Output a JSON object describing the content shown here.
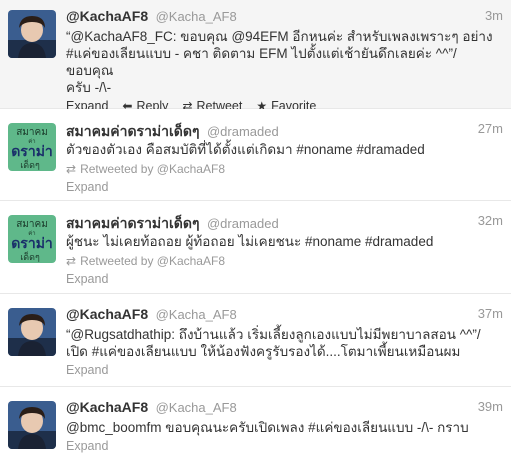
{
  "tweets": [
    {
      "fullname": "@KachaAF8",
      "username": "@Kacha_AF8",
      "time": "3m",
      "lines": [
        "“@KachaAF8_FC: ขอบคุณ @94EFM อีกหนค่ะ สำหรับเพลงเพราะๆ อย่าง",
        "#แค่ของเลียนแบบ - คชา ติดตาม EFM ไปตั้งแต่เช้ายันดึกเลยค่ะ ^^”/ขอบคุณ",
        "ครับ -/\\-"
      ],
      "expand": "Expand",
      "actions": {
        "reply": "Reply",
        "retweet": "Retweet",
        "favorite": "Favorite"
      },
      "avatar_icon": "person-photo",
      "highlight": true
    },
    {
      "fullname": "สมาคมค่าดราม่าเด็ดๆ",
      "username": "@dramaded",
      "time": "27m",
      "lines": [
        "ตัวของตัวเอง คือสมบัติที่ได้ตั้งแต่เกิดมา #noname #dramaded"
      ],
      "retweeted_by": "Retweeted by @KachaAF8",
      "expand": "Expand",
      "avatar_icon": "drama-logo",
      "avatar_text": {
        "top": "สมาคม",
        "mid": "ค่า",
        "main": "ดราม่า",
        "bottom": "เด็ดๆ"
      }
    },
    {
      "fullname": "สมาคมค่าดราม่าเด็ดๆ",
      "username": "@dramaded",
      "time": "32m",
      "lines": [
        "ผู้ชนะ ไม่เคยท้อถอย ผู้ท้อถอย ไม่เคยชนะ #noname #dramaded"
      ],
      "retweeted_by": "Retweeted by @KachaAF8",
      "expand": "Expand",
      "avatar_icon": "drama-logo",
      "avatar_text": {
        "top": "สมาคม",
        "mid": "ค่า",
        "main": "ดราม่า",
        "bottom": "เด็ดๆ"
      }
    },
    {
      "fullname": "@KachaAF8",
      "username": "@Kacha_AF8",
      "time": "37m",
      "lines": [
        "“@Rugsatdhathip: ถึงบ้านแล้ว เริ่มเลี้ยงลูกเองแบบไม่มีพยาบาลสอน ^^”/",
        "เปิด #แค่ของเลียนแบบ ให้น้องฟังครูรับรองได้....โตมาเพี้ยนเหมือนผม"
      ],
      "expand": "Expand",
      "avatar_icon": "person-photo"
    },
    {
      "fullname": "@KachaAF8",
      "username": "@Kacha_AF8",
      "time": "39m",
      "lines": [
        "@bmc_boomfm ขอบคุณนะครับเปิดเพลง #แค่ของเลียนแบบ -/\\- กราบ"
      ],
      "expand": "Expand",
      "avatar_icon": "person-photo"
    }
  ],
  "colors": {
    "link": "#333333",
    "meta": "#999999",
    "highlight_bg": "#f5f5f5",
    "logo_bg": "#5fb88a"
  }
}
